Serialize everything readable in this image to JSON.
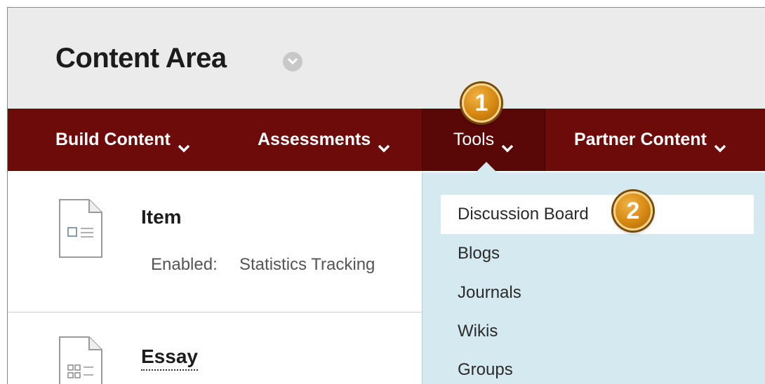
{
  "header": {
    "title": "Content Area"
  },
  "navbar": {
    "items": [
      {
        "label": "Build Content"
      },
      {
        "label": "Assessments"
      },
      {
        "label": "Tools"
      },
      {
        "label": "Partner Content"
      }
    ]
  },
  "dropdown": {
    "items": [
      {
        "label": "Discussion Board"
      },
      {
        "label": "Blogs"
      },
      {
        "label": "Journals"
      },
      {
        "label": "Wikis"
      },
      {
        "label": "Groups"
      }
    ]
  },
  "callouts": {
    "step1": "1",
    "step2": "2"
  },
  "content": {
    "items": [
      {
        "title": "Item",
        "meta_label": "Enabled:",
        "meta_value": "Statistics Tracking"
      },
      {
        "title": "Essay"
      }
    ]
  },
  "colors": {
    "navbar": "#6d0a0a",
    "navbar_active": "#5a0707",
    "dropdown": "#d5eaf0",
    "callout": "#d68812",
    "header": "#ebebeb"
  }
}
